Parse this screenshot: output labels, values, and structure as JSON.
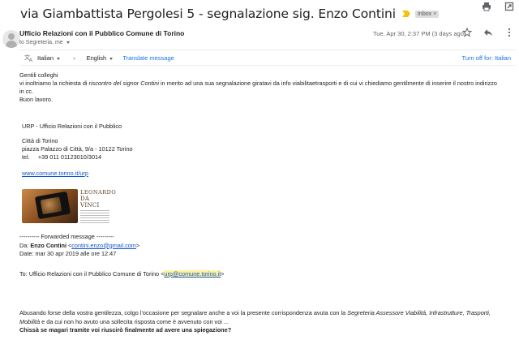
{
  "subject": "via Giambattista Pergolesi 5 - segnalazione sig. Enzo Contini",
  "label_badge": "Inbox",
  "sender": {
    "name": "Ufficio Relazioni con il Pubblico Comune di Torino",
    "recipients": "to Segreteria, me",
    "date": "Tue, Apr 30, 2:37 PM (3 days ago)"
  },
  "translate_bar": {
    "from_language": "Italian",
    "arrow": "›",
    "to_language": "English",
    "translate_link": "Translate message",
    "turn_off": "Turn off for: Italian"
  },
  "body": {
    "greeting": "Gentili colleghi",
    "line1_a": "vi inoltriamo la richiesta di ",
    "line1_italic": "riscontro del signor Contini",
    "line1_b": " in merito ad una sua segnalazione giratavi da info viabilitaetrasporti e  di cui vi chiediamo gentilmente di inserire il nostro indirizzo",
    "line2": "in cc.",
    "closing": "Buon lavoro."
  },
  "signature": {
    "org": "URP - Ufficio Relazioni con il Pubblico",
    "city": "Città di Torino",
    "address": "piazza Palazzo di Città, 9/a - 10122 Torino",
    "tel": "tel.     +39 011 01123010/3014",
    "website": "www.comune.torino.it/urp",
    "logo_line1": "LEONARDO",
    "logo_line2": "DA VINCI"
  },
  "forwarded": {
    "header": "---------- Forwarded message ---------",
    "from_label": "Da: ",
    "from_name": "Enzo Contini",
    "from_email": "contini.enzo@gmail.com",
    "date_line": "Date: mar 30 apr 2019 alle ore 12:47",
    "to_prefix": "To: Ufficio Relazioni con il Pubblico Comune di Torino <",
    "to_email": "urp@comune.torino.it",
    "to_suffix": ">"
  },
  "message": {
    "line1_a": "Abusando forse della vostra gentilezza, colgo l'occasione per segnalare anche a voi la presente corrispondenza avuta con la ",
    "line1_italic": "Segreteria Assessore Viabilità, Infrastrutture, Trasporti,",
    "line2_italic": "Mobilità",
    "line2_b": " e da cui non ho avuto una sollecita risposta come è avvenuto con voi ...",
    "line3_bold": "Chissà se magari tramite voi riuscirò finalmente ad avere una spiegazione?"
  },
  "icons": [
    "important-marker-icon",
    "close-icon",
    "print-icon",
    "open-in-new-window-icon",
    "avatar-icon",
    "star-icon",
    "reply-icon",
    "more-options-icon",
    "translate-icon"
  ]
}
